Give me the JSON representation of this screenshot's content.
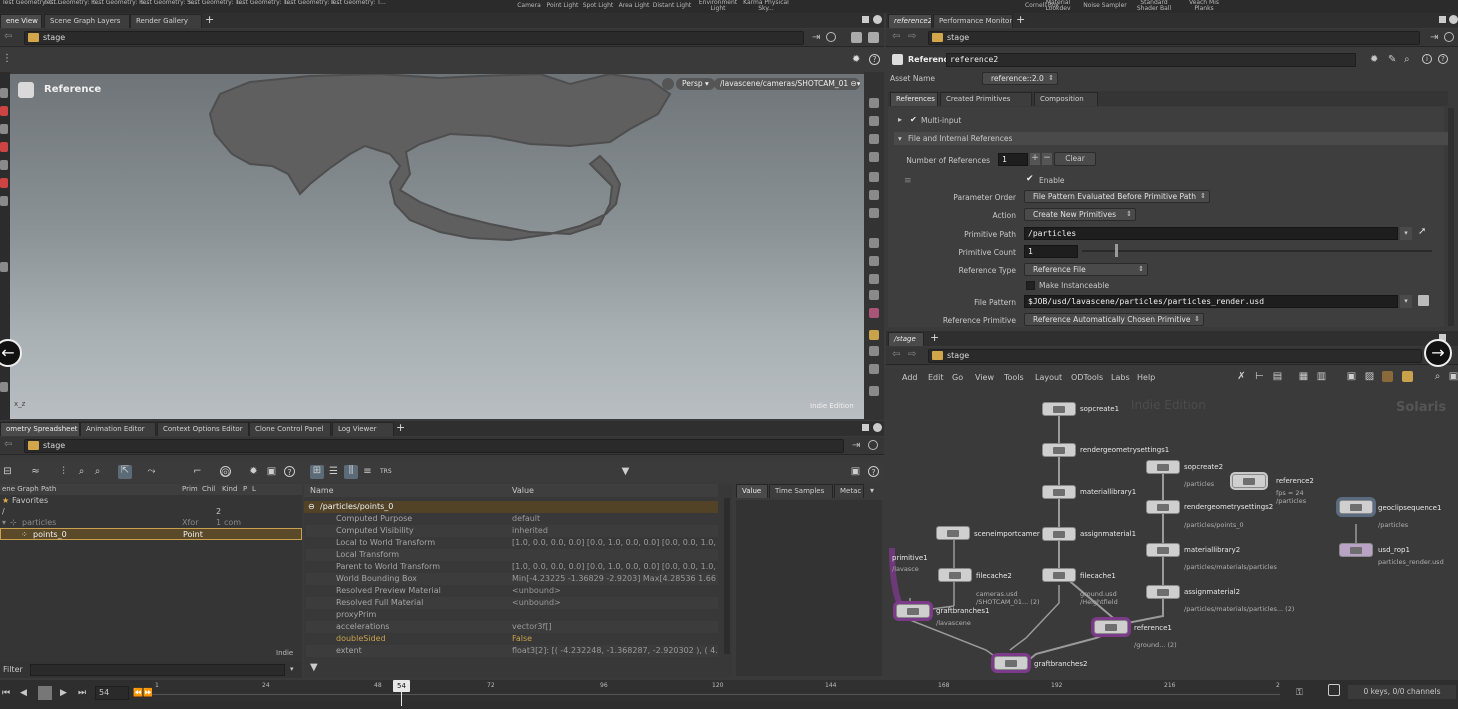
{
  "shelf": {
    "left_tools": [
      "Test Geometry: C...",
      "Test Geometry: P...",
      "Test Geometry: R...",
      "Test Geometry: S...",
      "Test Geometry: T...",
      "Test Geometry: T...",
      "Test Geometry: T..."
    ],
    "light_tools": [
      "Camera",
      "Point Light",
      "Spot Light",
      "Area Light",
      "Distant Light",
      "Environment Light",
      "Karma Physical Sky..."
    ],
    "right_tools": [
      "Cornell Box",
      "Material Lookdev",
      "Noise Sampler",
      "Standard Shader Ball",
      "Veach Mis Planks"
    ]
  },
  "left_panel": {
    "tabs": [
      "ene View",
      "Scene Graph Layers",
      "Render Gallery"
    ],
    "path": "stage",
    "viewport": {
      "node_name": "Reference",
      "persp": "Persp",
      "camera": "/lavascene/cameras/SHOTCAM_01",
      "watermark": "Indie Edition",
      "axis_label": "x_z"
    }
  },
  "bottom_left": {
    "tabs": [
      "ometry Spreadsheet",
      "Animation Editor",
      "Context Options Editor",
      "Clone Control Panel",
      "Log Viewer"
    ],
    "path": "stage",
    "tree_headers": [
      "ene Graph Path",
      "Prim",
      "Chil",
      "Kind",
      "P",
      "L"
    ],
    "tree_rows": [
      {
        "name": "Favorites",
        "prim": "",
        "chil": "",
        "kind": ""
      },
      {
        "name": "/",
        "prim": "",
        "chil": "2",
        "kind": ""
      },
      {
        "name": "particles",
        "prim": "Xfor",
        "chil": "1",
        "kind": "com"
      },
      {
        "name": "points_0",
        "prim": "Point",
        "chil": "",
        "kind": ""
      }
    ],
    "indie_badge": "Indie",
    "filter_label": "Filter",
    "props_headers": {
      "name": "Name",
      "value": "Value"
    },
    "props_path": "/particles/points_0",
    "props": [
      {
        "name": "Computed Purpose",
        "value": "default"
      },
      {
        "name": "Computed Visibility",
        "value": "inherited"
      },
      {
        "name": "Local to World Transform",
        "value": "[1.0, 0.0, 0.0,  0.0] [0.0, 1.0, 0.0,  0.0] [0.0, 0.0, 1.0,  0...."
      },
      {
        "name": "Local Transform",
        "value": ""
      },
      {
        "name": "Parent to World Transform",
        "value": "[1.0, 0.0, 0.0,  0.0] [0.0, 1.0, 0.0,  0.0] [0.0, 0.0, 1.0,  0...."
      },
      {
        "name": "World Bounding Box",
        "value": "Min[-4.23225 -1.36829 -2.9203] Max[4.28536 1.6614..."
      },
      {
        "name": "Resolved Preview Material",
        "value": "<unbound>"
      },
      {
        "name": "Resolved Full Material",
        "value": "<unbound>"
      },
      {
        "name": "proxyPrim",
        "value": ""
      },
      {
        "name": "accelerations",
        "value": "vector3f[]"
      },
      {
        "name": "doubleSided",
        "value": "False"
      },
      {
        "name": "extent",
        "value": "float3[2]: [( -4.232248, -1.368287, -2.920302 ), ( 4.28..."
      }
    ],
    "value_tabs": [
      "Value",
      "Time Samples",
      "Metac"
    ]
  },
  "right_top": {
    "tabs": [
      "reference2",
      "Performance Monitor"
    ],
    "path": "stage",
    "node_type": "Reference",
    "node_name": "reference2",
    "asset_name_label": "Asset Name",
    "asset_name_value": "reference::2.0",
    "param_tabs": [
      "References",
      "Created Primitives",
      "Composition"
    ],
    "multi_input": "Multi-input",
    "section": "File and Internal References",
    "num_refs_label": "Number of References",
    "num_refs_value": "1",
    "clear_label": "Clear",
    "enable_label": "Enable",
    "param_order_label": "Parameter Order",
    "param_order_value": "File Pattern Evaluated Before Primitive Path",
    "action_label": "Action",
    "action_value": "Create New Primitives",
    "prim_path_label": "Primitive Path",
    "prim_path_value": "/particles",
    "prim_count_label": "Primitive Count",
    "prim_count_value": "1",
    "prim_count_slider_fraction": 0.1,
    "ref_type_label": "Reference Type",
    "ref_type_value": "Reference File",
    "make_instanceable": "Make Instanceable",
    "file_pattern_label": "File Pattern",
    "file_pattern_value": "$JOB/usd/lavascene/particles/particles_render.usd",
    "ref_prim_label": "Reference Primitive",
    "ref_prim_value": "Reference Automatically Chosen Primitive"
  },
  "network": {
    "tab": "/stage",
    "path": "stage",
    "menu": [
      "Add",
      "Edit",
      "Go",
      "View",
      "Tools",
      "Layout",
      "ODTools",
      "Labs",
      "Help"
    ],
    "watermark": "Indie Edition",
    "context": "Solaris",
    "nodes": [
      {
        "label": "sopcreate1",
        "sub": ""
      },
      {
        "label": "rendergeometrysettings1",
        "sub": ""
      },
      {
        "label": "materiallibrary1",
        "sub": ""
      },
      {
        "label": "assignmaterial1",
        "sub": ""
      },
      {
        "label": "sceneimportcamer",
        "sub": ""
      },
      {
        "label": "primitive1",
        "sub": "/lavasce"
      },
      {
        "label": "filecache2",
        "sub": "cameras.usd /SHOTCAM_01... (2)"
      },
      {
        "label": "filecache1",
        "sub": "ground.usd /Heightfield"
      },
      {
        "label": "graftbranches1",
        "sub": "/lavascene"
      },
      {
        "label": "sopcreate2",
        "sub": "/particles"
      },
      {
        "label": "rendergeometrysettings2",
        "sub": "/particles/points_0"
      },
      {
        "label": "materiallibrary2",
        "sub": "/particles/materials/particles"
      },
      {
        "label": "assignmaterial2",
        "sub": "/particles/materials/particles... (2)"
      },
      {
        "label": "reference1",
        "sub": "/ground... (2)"
      },
      {
        "label": "graftbranches2",
        "sub": ""
      },
      {
        "label": "reference2",
        "sub": "fps = 24 /particles"
      },
      {
        "label": "geoclipsequence1",
        "sub": "/particles"
      },
      {
        "label": "usd_rop1",
        "sub": "particles_render.usd"
      }
    ]
  },
  "timeline": {
    "current_frame": "54",
    "marker": "54",
    "ticks": [
      "1",
      "24",
      "48",
      "72",
      "96",
      "120",
      "144",
      "168",
      "192",
      "216",
      "2"
    ],
    "keys_info": "0 keys, 0/0 channels"
  }
}
